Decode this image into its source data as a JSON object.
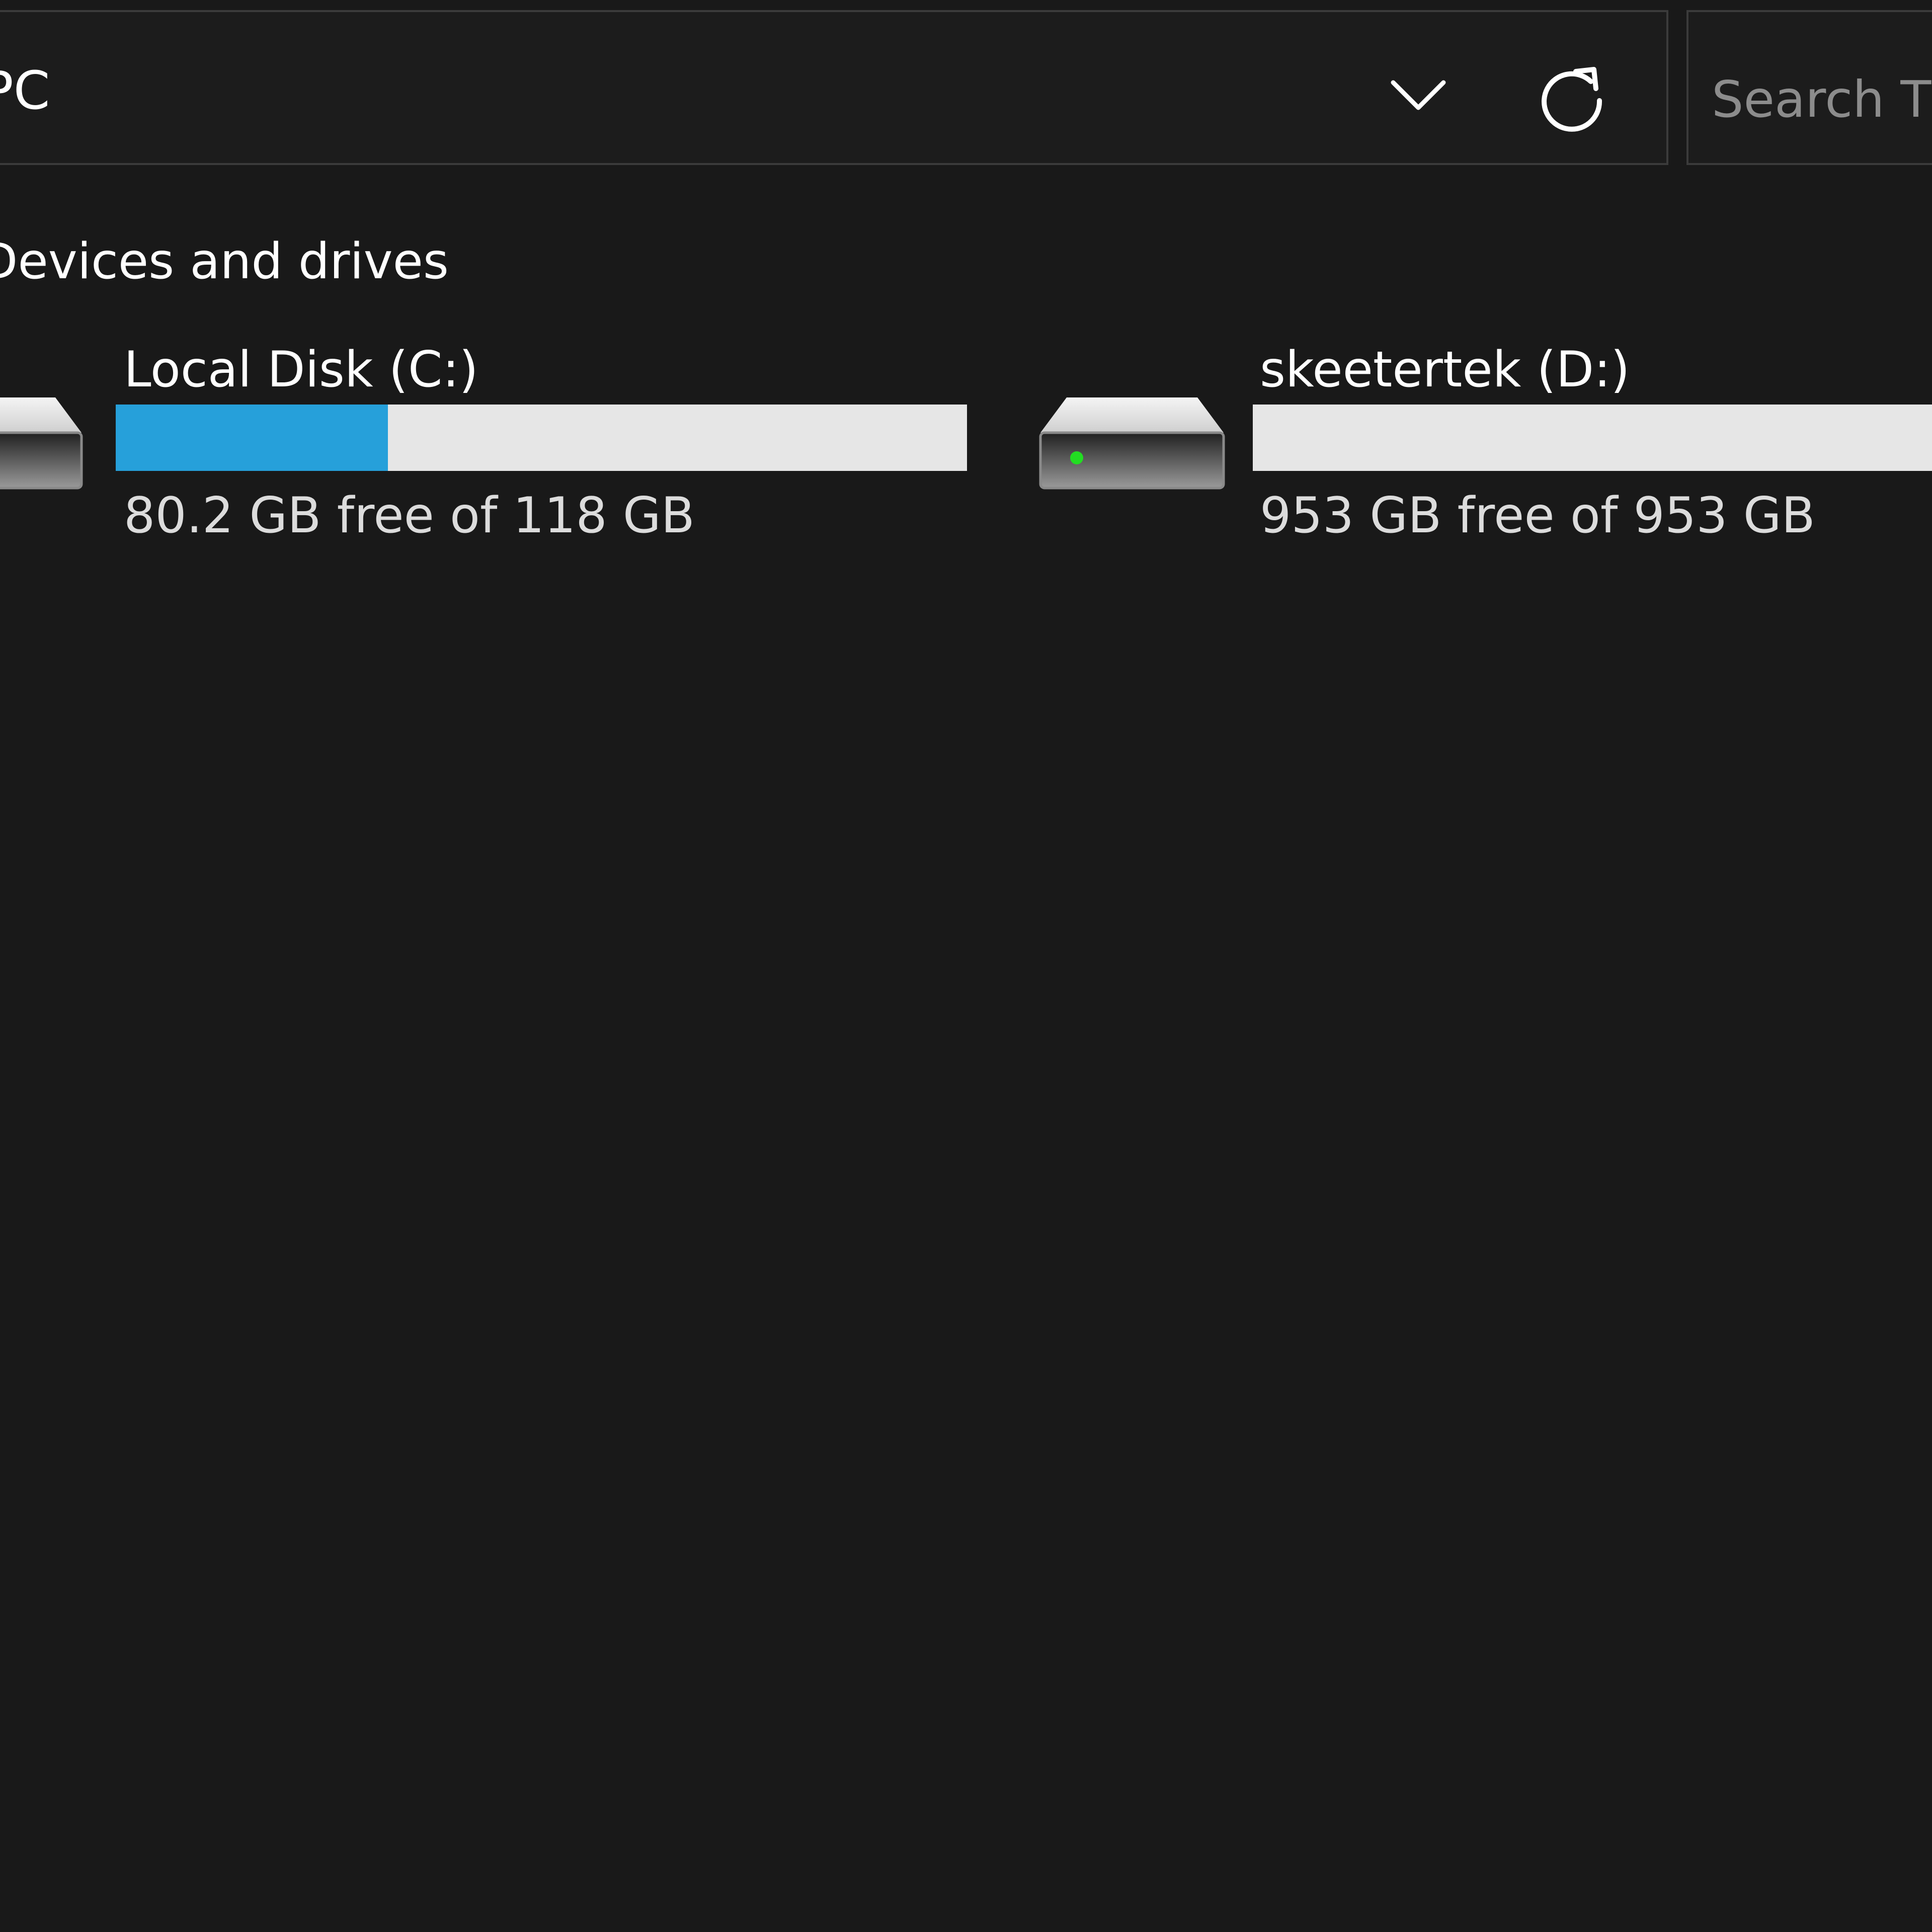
{
  "address_bar": {
    "path_text": "PC"
  },
  "search": {
    "placeholder": "Search This PC"
  },
  "section": {
    "heading": "Devices and drives"
  },
  "drives": [
    {
      "name": "Local Disk (C:)",
      "free_text": "80.2 GB free of 118 GB",
      "used_fraction": 0.32,
      "icon": "hard-drive-icon"
    },
    {
      "name": "skeetertek (D:)",
      "free_text": "953 GB free of 953 GB",
      "used_fraction": 0.0,
      "icon": "hard-drive-icon"
    }
  ],
  "colors": {
    "background": "#191919",
    "usage_fill": "#26a0da",
    "usage_track": "#e6e6e6",
    "drive_led": "#22dd22"
  }
}
